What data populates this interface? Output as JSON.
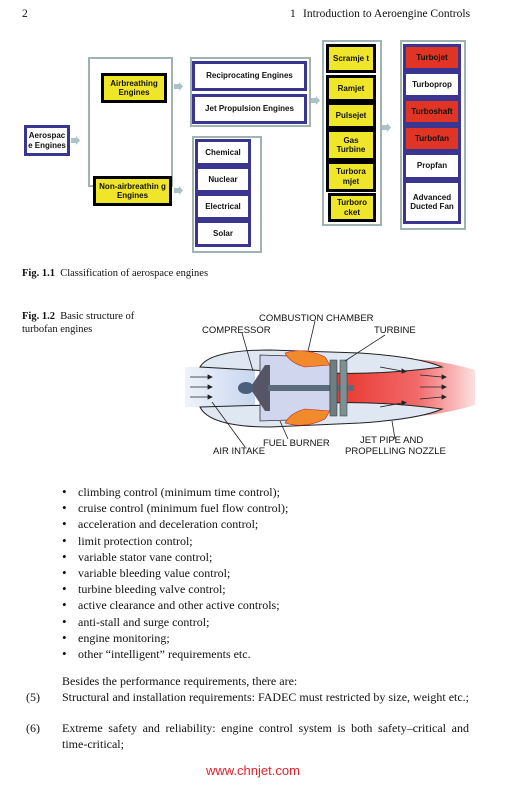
{
  "header": {
    "page_number": "2",
    "chapter_number": "1",
    "chapter_title": "Introduction to Aeroengine Controls"
  },
  "fig1": {
    "caption_label": "Fig. 1.1",
    "caption_text": "Classification of aerospace engines",
    "root": "Aerospac e Engines",
    "level1": [
      "Airbreathing Engines",
      "Non-airbreathin g Engines"
    ],
    "airbreathing": [
      "Reciprocating Engines",
      "Jet Propulsion Engines"
    ],
    "non_airbreathing": [
      "Chemical",
      "Nuclear",
      "Electrical",
      "Solar"
    ],
    "jet_types": [
      "Scramje t",
      "Ramjet",
      "Pulsejet",
      "Gas Turbine",
      "Turbora mjet",
      "Turboro cket"
    ],
    "gas_turbine_types": [
      {
        "label": "Turbojet",
        "color": "#e03424"
      },
      {
        "label": "Turboprop",
        "color": "#ffffff"
      },
      {
        "label": "Turboshaft",
        "color": "#e03424"
      },
      {
        "label": "Turbofan",
        "color": "#e03424"
      },
      {
        "label": "Propfan",
        "color": "#ffffff"
      },
      {
        "label": "Advanced Ducted Fan",
        "color": "#ffffff"
      }
    ]
  },
  "fig2": {
    "caption_label": "Fig. 1.2",
    "caption_text_line1": "Basic structure of",
    "caption_text_line2": "turbofan engines",
    "labels": {
      "combustion_chamber": "COMBUSTION CHAMBER",
      "compressor": "COMPRESSOR",
      "turbine": "TURBINE",
      "fuel_burner": "FUEL BURNER",
      "air_intake": "AIR INTAKE",
      "jet_pipe_1": "JET PIPE AND",
      "jet_pipe_2": "PROPELLING NOZZLE"
    }
  },
  "bullets": [
    "climbing control (minimum time control);",
    "cruise control (minimum fuel flow control);",
    "acceleration and deceleration control;",
    "limit protection control;",
    "variable stator vane control;",
    "variable bleeding value control;",
    "turbine bleeding valve control;",
    "active clearance and other active controls;",
    "anti-stall and surge control;",
    "engine monitoring;",
    "other “intelligent” requirements etc."
  ],
  "body": {
    "intro": "Besides the performance requirements, there are:",
    "items": [
      {
        "num": "(5)",
        "text": "Structural and installation requirements: FADEC must restricted by size, weight etc.;"
      },
      {
        "num": "(6)",
        "text": "Extreme safety and reliability: engine control system is both safety–critical and time-critical;"
      }
    ]
  },
  "watermark": "www.chnjet.com"
}
